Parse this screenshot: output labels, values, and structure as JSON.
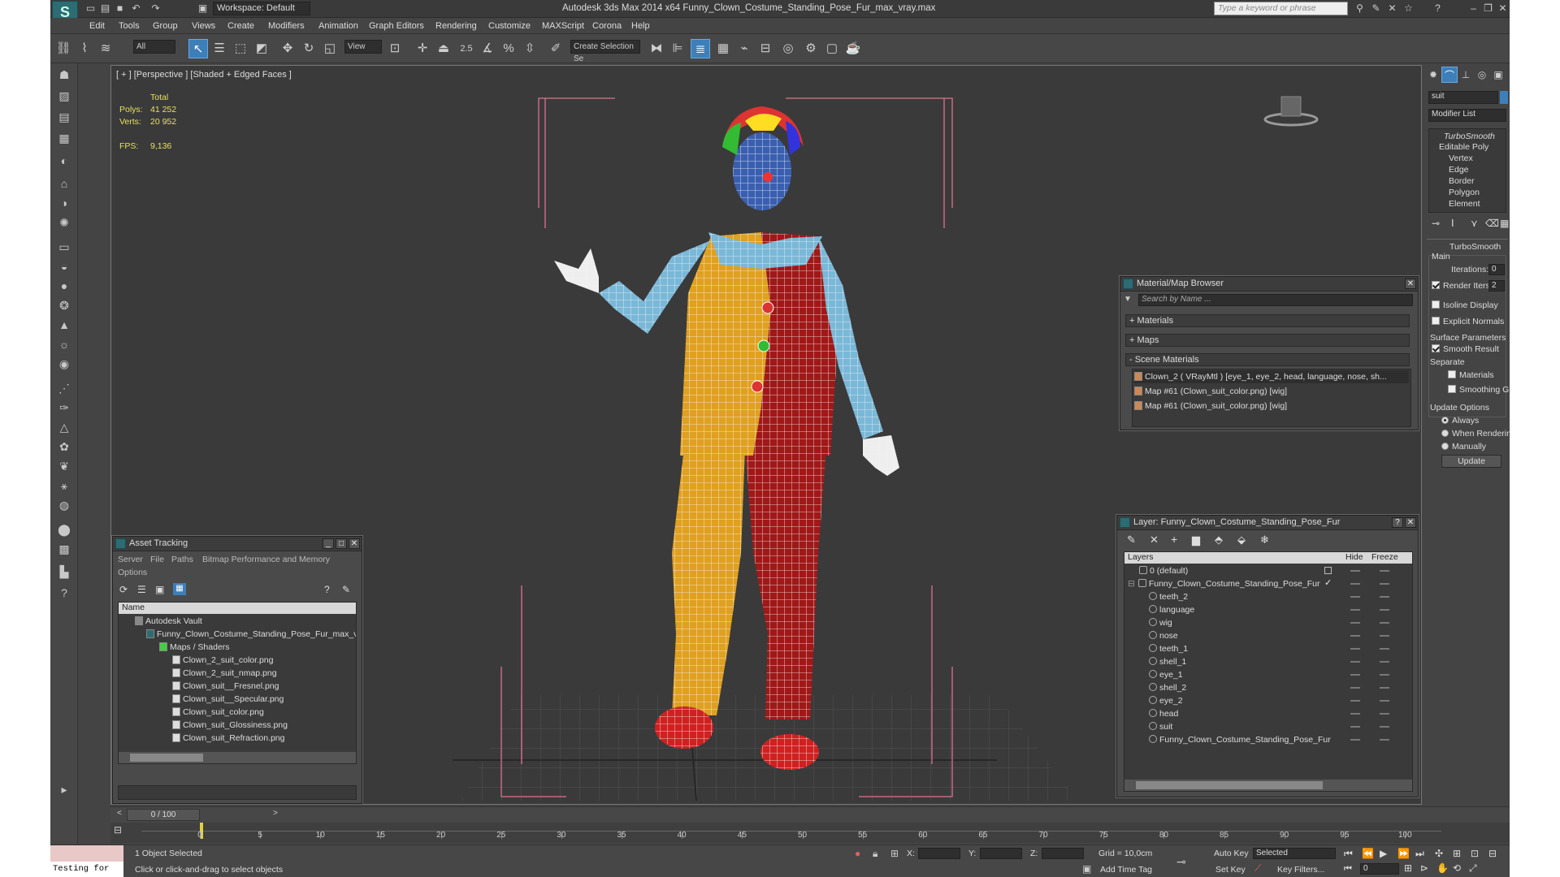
{
  "titlebar": {
    "workspace": "Workspace: Default",
    "title": "Autodesk 3ds Max  2014 x64     Funny_Clown_Costume_Standing_Pose_Fur_max_vray.max",
    "search_placeholder": "Type a keyword or phrase"
  },
  "menu": [
    "Edit",
    "Tools",
    "Group",
    "Views",
    "Create",
    "Modifiers",
    "Animation",
    "Graph Editors",
    "Rendering",
    "Customize",
    "MAXScript",
    "Corona",
    "Help"
  ],
  "toolbar": {
    "selection_filter": "All",
    "ref_coord": "View",
    "snap_value": "2.5",
    "named_selection": "Create Selection Se"
  },
  "viewport": {
    "label": "[ + ] [Perspective ] [Shaded + Edged Faces ]",
    "stats_total": "Total",
    "polys_label": "Polys:",
    "polys_value": "41 252",
    "verts_label": "Verts:",
    "verts_value": "20 952",
    "fps_label": "FPS:",
    "fps_value": "9,136"
  },
  "command_panel": {
    "object_name": "suit",
    "modifier_list": "Modifier List",
    "stack": [
      "TurboSmooth",
      "Editable Poly",
      "Vertex",
      "Edge",
      "Border",
      "Polygon",
      "Element"
    ],
    "rollout_title": "TurboSmooth",
    "main_label": "Main",
    "iterations_label": "Iterations:",
    "iterations_value": "0",
    "render_iters_label": "Render Iters:",
    "render_iters_value": "2",
    "isoline_display": "Isoline Display",
    "explicit_normals": "Explicit Normals",
    "surface_params": "Surface Parameters",
    "smooth_result": "Smooth Result",
    "separate": "Separate",
    "materials": "Materials",
    "smoothing_groups": "Smoothing Groups",
    "update_options": "Update Options",
    "always": "Always",
    "when_rendering": "When Rendering",
    "manually": "Manually",
    "update_button": "Update"
  },
  "material_browser": {
    "title": "Material/Map Browser",
    "search_placeholder": "Search by Name ...",
    "sections": [
      "+ Materials",
      "+ Maps",
      "- Scene Materials"
    ],
    "items": [
      "Clown_2  ( VRayMtl )  [eye_1, eye_2, head, language, nose, sh...",
      "Map #61 (Clown_suit_color.png)  [wig]",
      "Map #61 (Clown_suit_color.png)  [wig]"
    ]
  },
  "asset_tracking": {
    "title": "Asset Tracking",
    "menu": [
      "Server",
      "File",
      "Paths",
      "Bitmap Performance and Memory"
    ],
    "options": "Options",
    "column": "Name",
    "vault": "Autodesk Vault",
    "file": "Funny_Clown_Costume_Standing_Pose_Fur_max_vra",
    "maps_folder": "Maps / Shaders",
    "maps": [
      "Clown_2_suit_color.png",
      "Clown_2_suit_nmap.png",
      "Clown_suit__Fresnel.png",
      "Clown_suit__Specular.png",
      "Clown_suit_color.png",
      "Clown_suit_Glossiness.png",
      "Clown_suit_Refraction.png"
    ]
  },
  "layer_panel": {
    "title": "Layer: Funny_Clown_Costume_Standing_Pose_Fur",
    "col_layers": "Layers",
    "col_hide": "Hide",
    "col_freeze": "Freeze",
    "default_layer": "0 (default)",
    "main_layer": "Funny_Clown_Costume_Standing_Pose_Fur",
    "children": [
      "teeth_2",
      "language",
      "wig",
      "nose",
      "teeth_1",
      "shell_1",
      "eye_1",
      "shell_2",
      "eye_2",
      "head",
      "suit",
      "Funny_Clown_Costume_Standing_Pose_Fur"
    ]
  },
  "timeline": {
    "frame_counter": "0 / 100",
    "ticks": [
      "0",
      "5",
      "10",
      "15",
      "20",
      "25",
      "30",
      "35",
      "40",
      "45",
      "50",
      "55",
      "60",
      "65",
      "70",
      "75",
      "80",
      "85",
      "90",
      "95",
      "100"
    ]
  },
  "status": {
    "maxscript": "Testing for",
    "selected": "1 Object Selected",
    "prompt": "Click or click-and-drag to select objects",
    "x_label": "X:",
    "y_label": "Y:",
    "z_label": "Z:",
    "grid": "Grid = 10,0cm",
    "add_time_tag": "Add Time Tag",
    "auto_key": "Auto Key",
    "set_key": "Set Key",
    "selected_dd": "Selected",
    "key_filters": "Key Filters...",
    "frame": "0"
  },
  "colors": {
    "accent_blue": "#3d7fb8",
    "stats_yellow": "#e8e060",
    "suit_yellow": "#e0a020",
    "suit_red": "#a01818",
    "collar_blue": "#7ab8d8"
  }
}
